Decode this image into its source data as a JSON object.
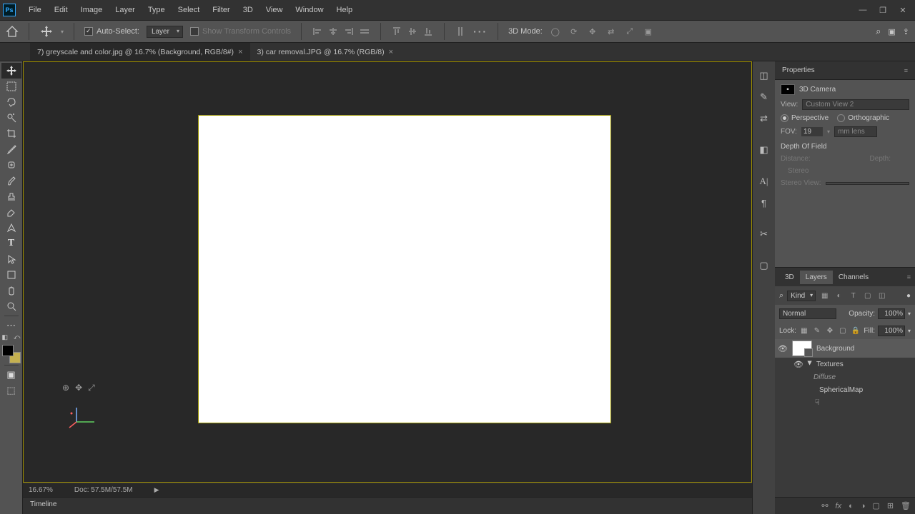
{
  "menus": [
    "File",
    "Edit",
    "Image",
    "Layer",
    "Type",
    "Select",
    "Filter",
    "3D",
    "View",
    "Window",
    "Help"
  ],
  "options": {
    "auto_select": "Auto-Select:",
    "auto_select_target": "Layer",
    "show_transform": "Show Transform Controls",
    "mode3d": "3D Mode:"
  },
  "tabs": [
    {
      "title": "7) greyscale and color.jpg @ 16.7% (Background, RGB/8#)",
      "active": true
    },
    {
      "title": "3) car removal.JPG @ 16.7% (RGB/8)",
      "active": false
    }
  ],
  "status": {
    "zoom": "16.67%",
    "doc": "Doc: 57.5M/57.5M"
  },
  "timeline": {
    "label": "Timeline"
  },
  "properties": {
    "title": "Properties",
    "type": "3D Camera",
    "view_label": "View:",
    "view_value": "Custom View 2",
    "perspective": "Perspective",
    "orthographic": "Orthographic",
    "fov_label": "FOV:",
    "fov_value": "19",
    "fov_unit": "mm lens",
    "dof": "Depth Of Field",
    "distance": "Distance:",
    "depth": "Depth:",
    "stereo": "Stereo",
    "stereo_view": "Stereo View:"
  },
  "layers_panel": {
    "tabs": [
      "3D",
      "Layers",
      "Channels"
    ],
    "active_tab": "Layers",
    "kind": "Kind",
    "blend_mode": "Normal",
    "opacity_label": "Opacity:",
    "opacity": "100%",
    "lock_label": "Lock:",
    "fill_label": "Fill:",
    "fill": "100%",
    "layers": {
      "bg_name": "Background",
      "textures": "Textures",
      "diffuse": "Diffuse",
      "spherical": "SphericalMap"
    }
  }
}
